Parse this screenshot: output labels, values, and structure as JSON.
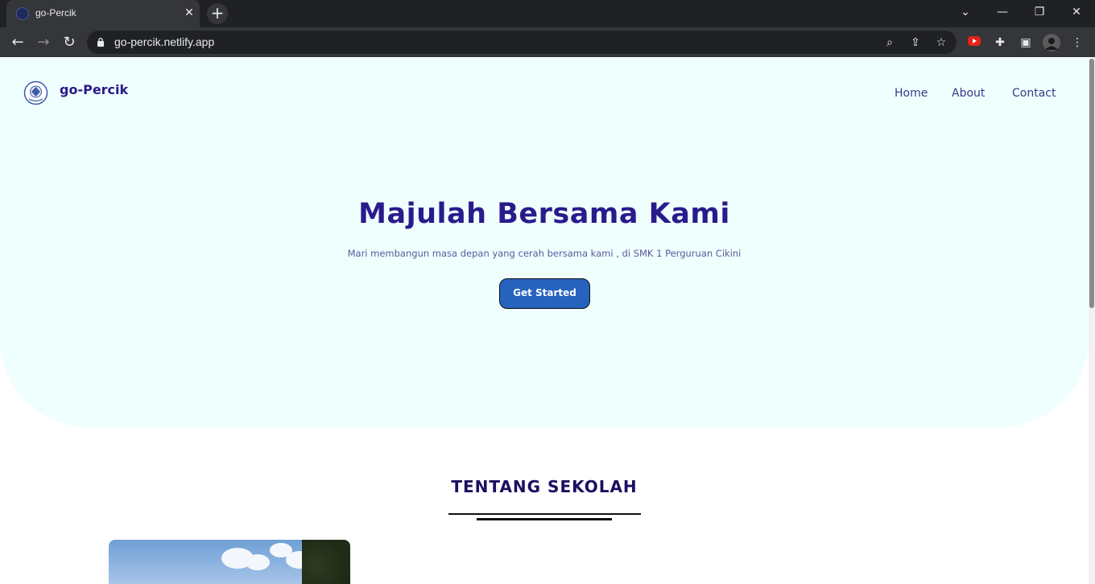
{
  "browser": {
    "tab_title": "go-Percik",
    "url": "go-percik.netlify.app"
  },
  "site": {
    "brand": "go-Percik",
    "nav": [
      "Home",
      "About",
      "Contact"
    ]
  },
  "hero": {
    "title": "Majulah Bersama Kami",
    "subtitle": "Mari membangun masa depan yang cerah bersama kami , di SMK 1 Perguruan Cikini",
    "cta_label": "Get Started"
  },
  "about": {
    "title": "TENTANG SEKOLAH"
  },
  "colors": {
    "hero_bg": "#effffe",
    "brand": "#2a1b8c",
    "button": "#2563be"
  }
}
